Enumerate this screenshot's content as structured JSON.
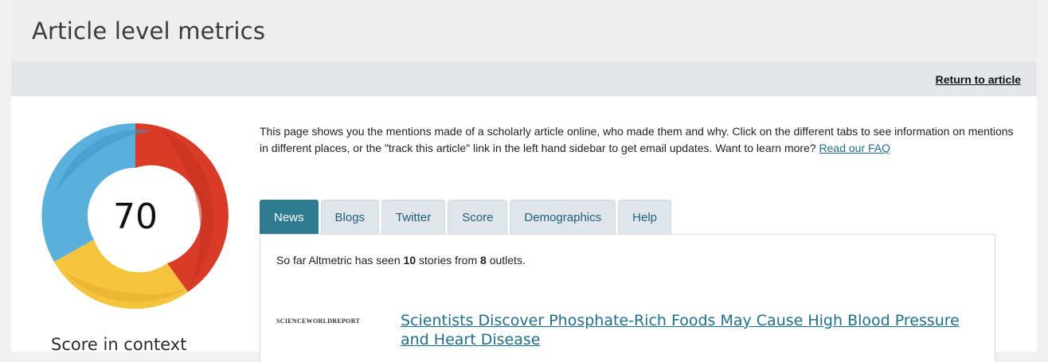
{
  "header": {
    "title": "Article level metrics"
  },
  "subbar": {
    "return_link": "Return to article"
  },
  "score": {
    "value": "70",
    "context_label": "Score in context"
  },
  "intro": {
    "text": "This page shows you the mentions made of a scholarly article online, who made them and why. Click on the different tabs to see information on mentions in different places, or the \"track this article\" link in the left hand sidebar to get email updates. Want to learn more?",
    "faq_link": "Read our FAQ"
  },
  "tabs": [
    {
      "label": "News",
      "active": true
    },
    {
      "label": "Blogs",
      "active": false
    },
    {
      "label": "Twitter",
      "active": false
    },
    {
      "label": "Score",
      "active": false
    },
    {
      "label": "Demographics",
      "active": false
    },
    {
      "label": "Help",
      "active": false
    }
  ],
  "news": {
    "summary_prefix": "So far Altmetric has seen ",
    "stories_count": "10",
    "summary_mid": " stories from ",
    "outlets_count": "8",
    "summary_suffix": " outlets.",
    "items": [
      {
        "outlet": "SCIENCEWORLDREPORT",
        "headline": "Scientists Discover Phosphate-Rich Foods May Cause High Blood Pressure and Heart Disease"
      }
    ]
  },
  "colors": {
    "accent": "#2e7a8e",
    "link": "#1c6f8e",
    "donut_red": "#d93b27",
    "donut_blue": "#5ab0dd",
    "donut_yellow": "#f4c43c"
  }
}
